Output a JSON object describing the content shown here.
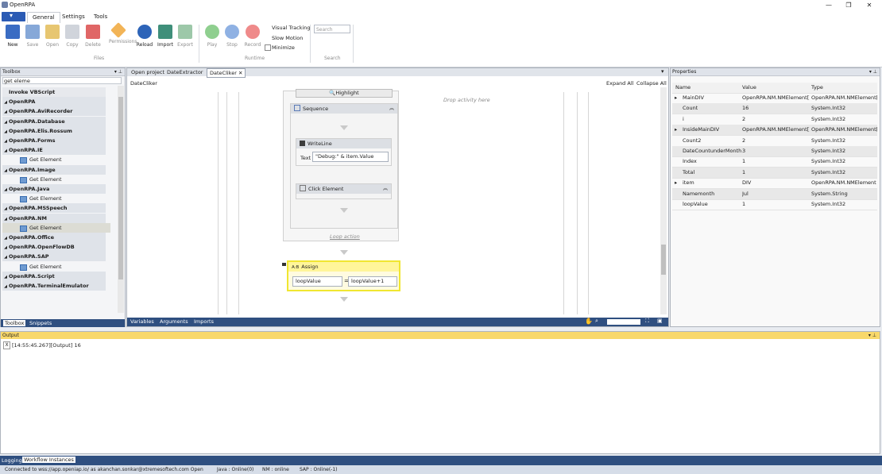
{
  "window": {
    "title": "OpenRPA",
    "min": "—",
    "restore": "❐",
    "close": "✕"
  },
  "ribbon_tabs": [
    "General",
    "Settings",
    "Tools"
  ],
  "ribbon": {
    "buttons": [
      {
        "label": "New",
        "color": "#3a6cc3"
      },
      {
        "label": "Save",
        "color": "#86a8d8"
      },
      {
        "label": "Open",
        "color": "#e7c671"
      },
      {
        "label": "Copy",
        "color": "#d0d4db"
      },
      {
        "label": "Delete",
        "color": "#e06666"
      },
      {
        "label": "Permissions",
        "color": "#f2b457"
      },
      {
        "label": "Reload",
        "color": "#2d64b8"
      },
      {
        "label": "Import",
        "color": "#3f8f7a"
      },
      {
        "label": "Export",
        "color": "#9dc8a9"
      },
      {
        "label": "Play",
        "color": "#8fcf8f"
      },
      {
        "label": "Stop",
        "color": "#8fb1e3"
      },
      {
        "label": "Record",
        "color": "#ef8a8a"
      }
    ],
    "groups": {
      "file": "Files",
      "runtime": "Runtime",
      "search": "Search"
    },
    "visual_tracking": "Visual Tracking",
    "slow_motion": "Slow Motion",
    "minimize": "Minimize",
    "search_placeholder": "Search"
  },
  "toolbox": {
    "title": "Toolbox",
    "pin": "▾ ⊥",
    "search_value": "get eleme",
    "items": [
      {
        "label": "Invoke VBScript",
        "type": "sub_plain"
      },
      {
        "label": "OpenRPA",
        "type": "cat"
      },
      {
        "label": "OpenRPA.AviRecorder",
        "type": "cat"
      },
      {
        "label": "OpenRPA.Database",
        "type": "cat"
      },
      {
        "label": "OpenRPA.Elis.Rossum",
        "type": "cat"
      },
      {
        "label": "OpenRPA.Forms",
        "type": "cat"
      },
      {
        "label": "OpenRPA.IE",
        "type": "cat"
      },
      {
        "label": "Get Element",
        "type": "sub"
      },
      {
        "label": "OpenRPA.Image",
        "type": "cat"
      },
      {
        "label": "Get Element",
        "type": "sub"
      },
      {
        "label": "OpenRPA.Java",
        "type": "cat"
      },
      {
        "label": "Get Element",
        "type": "sub"
      },
      {
        "label": "OpenRPA.MSSpeech",
        "type": "cat"
      },
      {
        "label": "OpenRPA.NM",
        "type": "cat"
      },
      {
        "label": "Get Element",
        "type": "sub_sel"
      },
      {
        "label": "OpenRPA.Office",
        "type": "cat"
      },
      {
        "label": "OpenRPA.OpenFlowDB",
        "type": "cat"
      },
      {
        "label": "OpenRPA.SAP",
        "type": "cat"
      },
      {
        "label": "Get Element",
        "type": "sub"
      },
      {
        "label": "OpenRPA.Script",
        "type": "cat"
      },
      {
        "label": "OpenRPA.TerminalEmulator",
        "type": "cat"
      }
    ],
    "tabs": [
      "Toolbox",
      "Snippets"
    ]
  },
  "designer": {
    "tabs": [
      "Open project",
      "DateExtractor",
      "DateCliker ✕"
    ],
    "breadcrumb": "DateCliker",
    "expand_all": "Expand All",
    "collapse_all": "Collapse All",
    "highlight": "Highlight",
    "sequence": "Sequence",
    "writeline": "WriteLine",
    "text_label": "Text",
    "text_value": "\"Debug:\" & item.Value",
    "click_element": "Click Element",
    "loop_action": "Loop action",
    "drop_here": "Drop activity here",
    "assign": "Assign",
    "assign_icon": "A:B",
    "assign_to": "loopValue",
    "assign_eq": "=",
    "assign_value": "loopValue+1",
    "bottom_tabs": [
      "Variables",
      "Arguments",
      "Imports"
    ]
  },
  "properties": {
    "title": "Properties",
    "columns": [
      "Name",
      "Value",
      "Type"
    ],
    "rows": [
      {
        "expand": "▸",
        "name": "MainDIV",
        "value": "OpenRPA.NM.NMElement[]",
        "type": "OpenRPA.NM.NMElement[]"
      },
      {
        "expand": "",
        "name": "Count",
        "value": "16",
        "type": "System.Int32"
      },
      {
        "expand": "",
        "name": "i",
        "value": "2",
        "type": "System.Int32"
      },
      {
        "expand": "▸",
        "name": "InsideMainDIV",
        "value": "OpenRPA.NM.NMElement[]",
        "type": "OpenRPA.NM.NMElement[]"
      },
      {
        "expand": "",
        "name": "Count2",
        "value": "2",
        "type": "System.Int32"
      },
      {
        "expand": "",
        "name": "DateCountunderMonth",
        "value": "3",
        "type": "System.Int32"
      },
      {
        "expand": "",
        "name": "Index",
        "value": "1",
        "type": "System.Int32"
      },
      {
        "expand": "",
        "name": "Total",
        "value": "1",
        "type": "System.Int32"
      },
      {
        "expand": "▸",
        "name": "item",
        "value": "DIV",
        "type": "OpenRPA.NM.NMElement"
      },
      {
        "expand": "",
        "name": "Namemonth",
        "value": "Jul",
        "type": "System.String"
      },
      {
        "expand": "",
        "name": "loopValue",
        "value": "1",
        "type": "System.Int32"
      }
    ]
  },
  "output": {
    "title": "Output",
    "clear": "X",
    "line": "[14:55:45.267][Output] 16"
  },
  "bottom_tabs": [
    "Logging",
    "Workflow Instances"
  ],
  "status": {
    "connected": "Connected to wss://app.openiap.io/ as akanchan.sonkar@xtremesoftech.com  Open",
    "java": "Java : Online(0)",
    "nm": "NM : online",
    "sap": "SAP : Online(-1)"
  }
}
